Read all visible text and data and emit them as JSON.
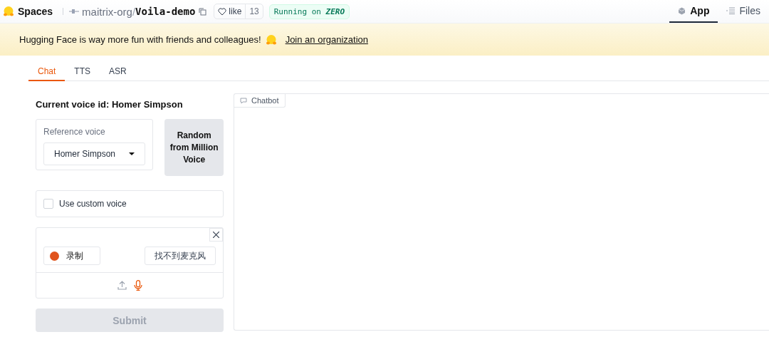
{
  "header": {
    "brand": "Spaces",
    "owner": "maitrix-org",
    "separator": "/",
    "repo": "Voila-demo",
    "like_label": "like",
    "like_count": "13",
    "runtime_prefix": "Running on",
    "runtime_name": "ZERO",
    "nav": [
      {
        "label": "App",
        "kind": "app",
        "selected": true
      },
      {
        "label": "Files",
        "kind": "files",
        "selected": false
      }
    ]
  },
  "banner": {
    "message": "Hugging Face is way more fun with friends and colleagues!",
    "link": "Join an organization"
  },
  "tabs": [
    {
      "label": "Chat",
      "selected": true
    },
    {
      "label": "TTS",
      "selected": false
    },
    {
      "label": "ASR",
      "selected": false
    }
  ],
  "voice": {
    "heading": "Current voice id: Homer Simpson",
    "reference_label": "Reference voice",
    "reference_value": "Homer Simpson",
    "random_button": "Random from Million Voice",
    "custom_voice": {
      "label": "Use custom voice",
      "checked": false
    }
  },
  "recorder": {
    "record_button": "录制",
    "mic_button": "找不到麦克风",
    "sources": [
      {
        "kind": "upload",
        "selected": false
      },
      {
        "kind": "microphone",
        "selected": true
      }
    ]
  },
  "submit": {
    "label": "Submit",
    "disabled": true
  },
  "chatbot": {
    "label": "Chatbot"
  }
}
